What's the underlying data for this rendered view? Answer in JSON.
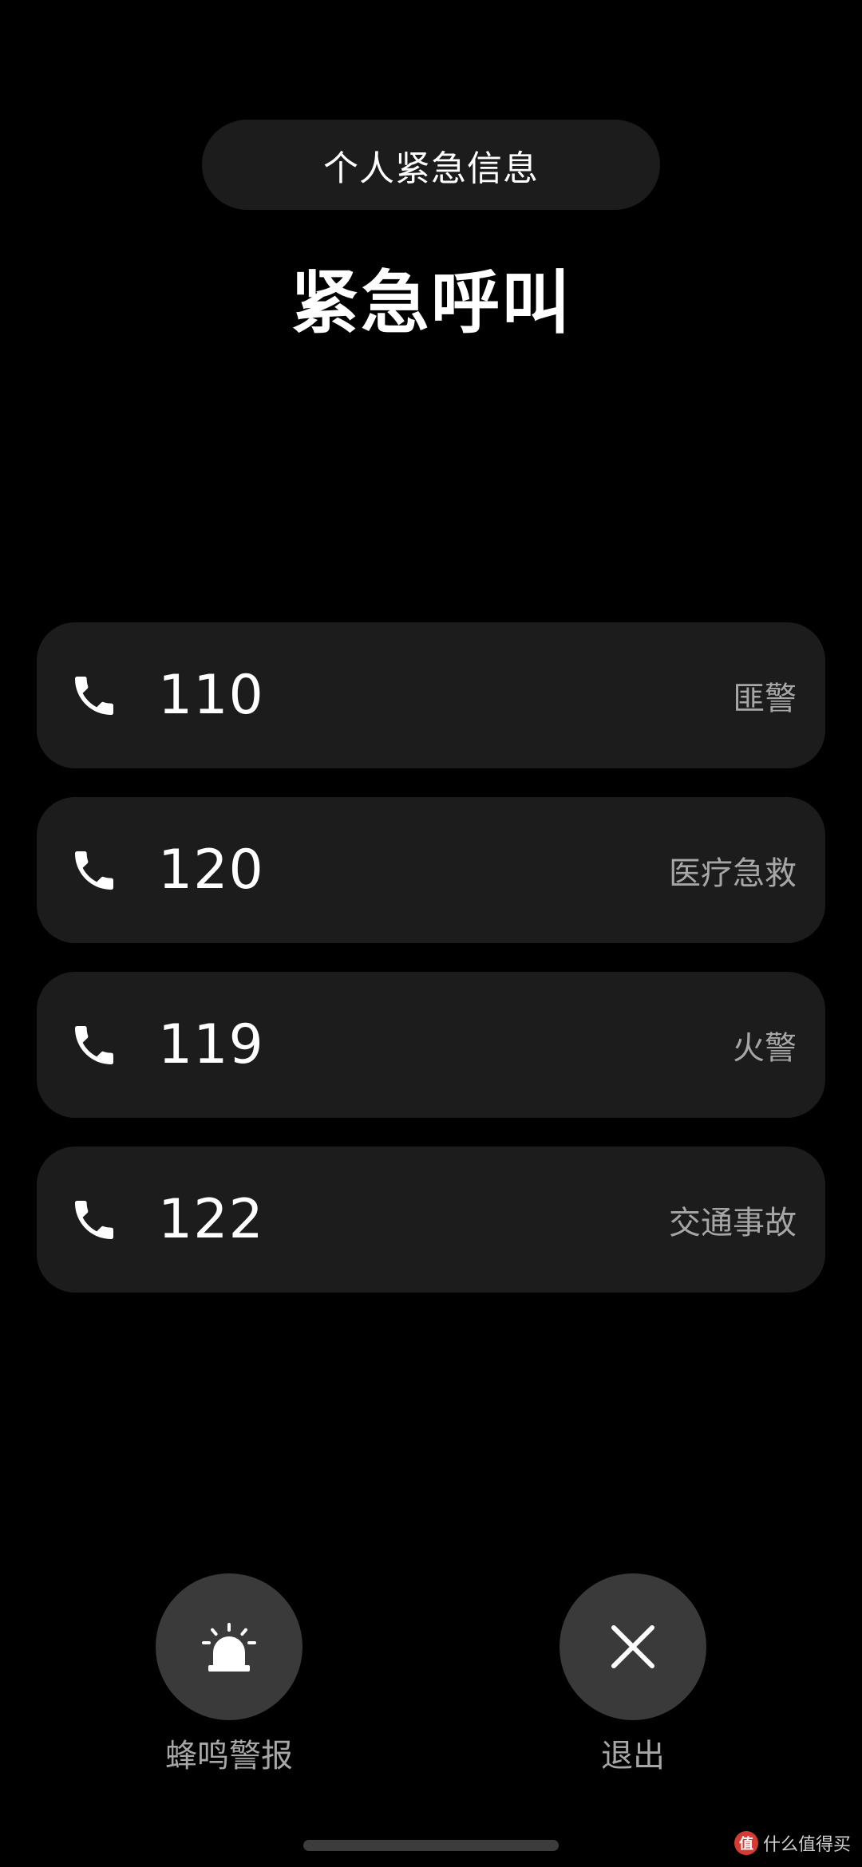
{
  "header": {
    "info_button_label": "个人紧急信息",
    "title": "紧急呼叫"
  },
  "emergency_numbers": [
    {
      "number": "110",
      "service": "匪警",
      "icon": "phone-icon"
    },
    {
      "number": "120",
      "service": "医疗急救",
      "icon": "phone-icon"
    },
    {
      "number": "119",
      "service": "火警",
      "icon": "phone-icon"
    },
    {
      "number": "122",
      "service": "交通事故",
      "icon": "phone-icon"
    }
  ],
  "actions": {
    "siren": {
      "label": "蜂鸣警报",
      "icon": "siren-icon"
    },
    "exit": {
      "label": "退出",
      "icon": "close-icon"
    }
  },
  "watermark": {
    "logo_text": "值",
    "text": "什么值得买"
  },
  "colors": {
    "background": "#000000",
    "card": "#1c1c1c",
    "round_button": "#3a3a3a",
    "secondary_text": "#a6a6a6",
    "primary_text": "#ffffff"
  }
}
